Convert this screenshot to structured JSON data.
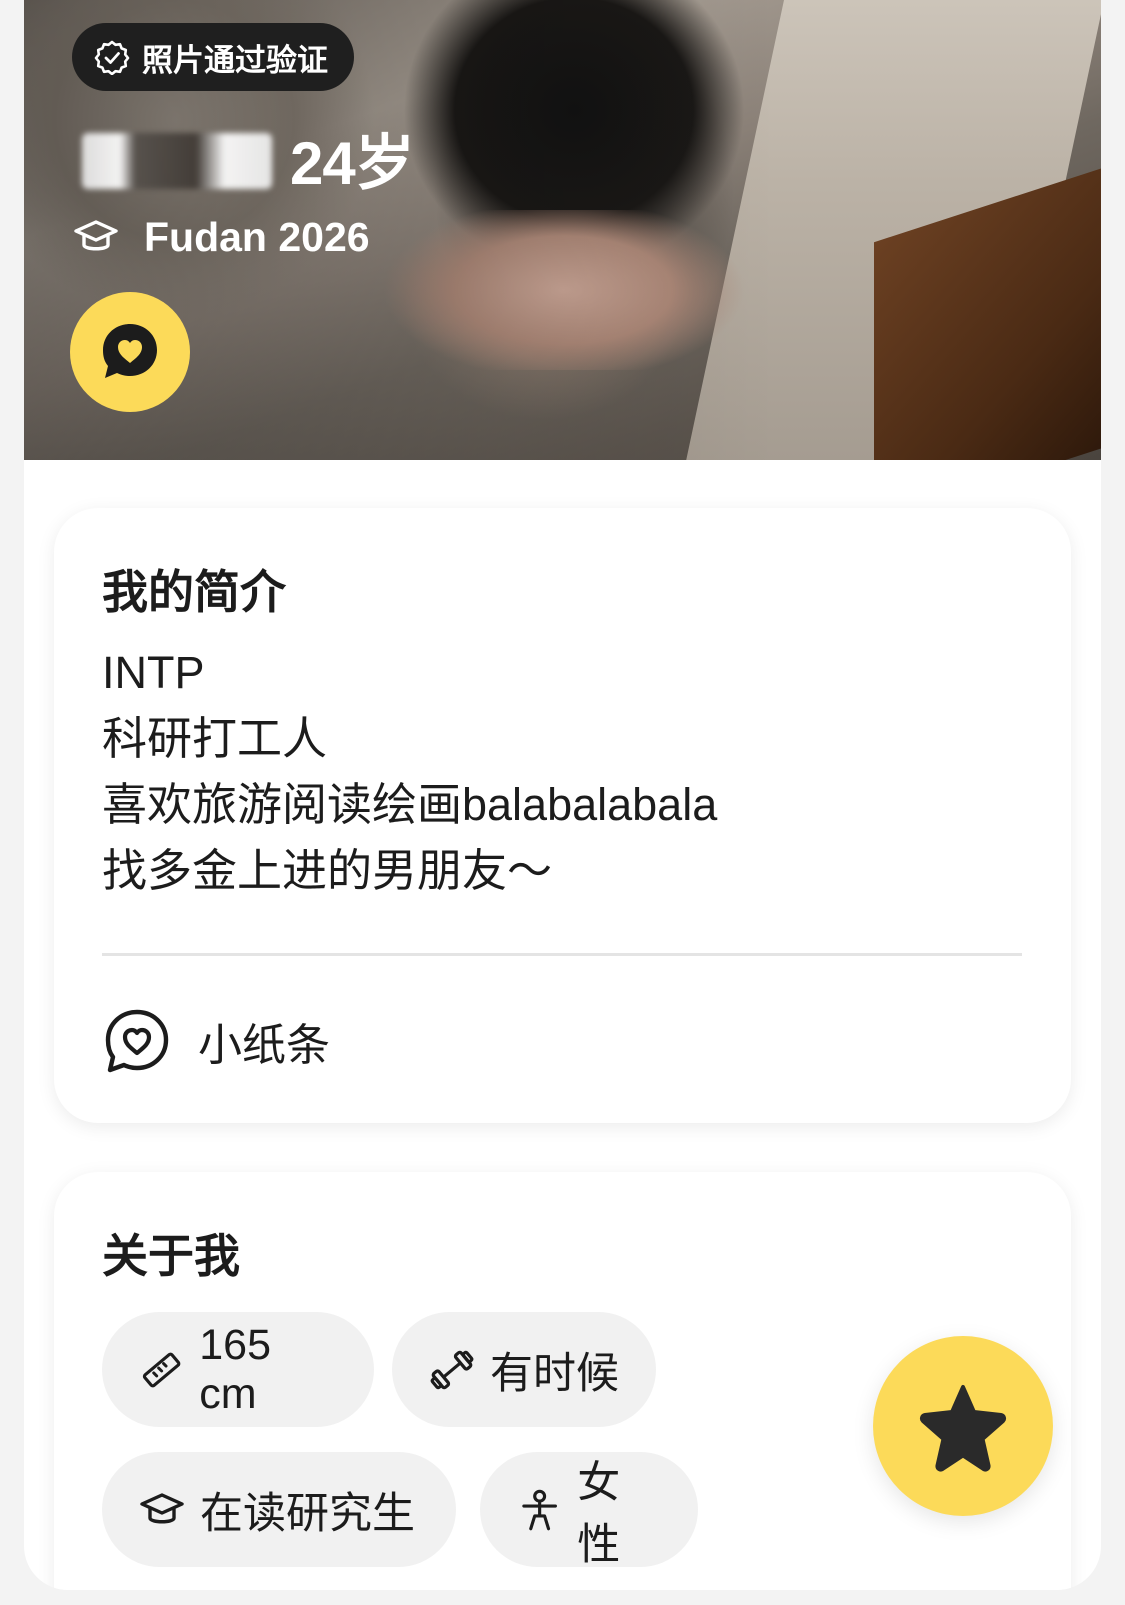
{
  "hero": {
    "verified_badge": "照片通过验证",
    "name_blurred": true,
    "age": "24岁",
    "school": "Fudan 2026"
  },
  "intro": {
    "title": "我的简介",
    "bio_lines": [
      "INTP",
      "科研打工人",
      "喜欢旅游阅读绘画balabalabala",
      "找多金上进的男朋友～"
    ],
    "note_label": "小纸条"
  },
  "about": {
    "title": "关于我",
    "chips": {
      "height": "165 cm",
      "exercise": "有时候",
      "education": "在读研究生",
      "gender": "女性"
    }
  },
  "icons": {
    "badge": "verified-check-icon",
    "school": "graduation-cap-icon",
    "hero_button": "chat-heart-icon",
    "note": "chat-heart-outline-icon",
    "height": "ruler-icon",
    "exercise": "dumbbell-icon",
    "education": "graduation-cap-icon",
    "gender": "person-icon",
    "fab": "star-icon"
  },
  "colors": {
    "accent": "#fcda59",
    "badge_bg": "#1f1f1f",
    "chip_bg": "#f1f1f1",
    "page_bg": "#f3f3f3"
  }
}
